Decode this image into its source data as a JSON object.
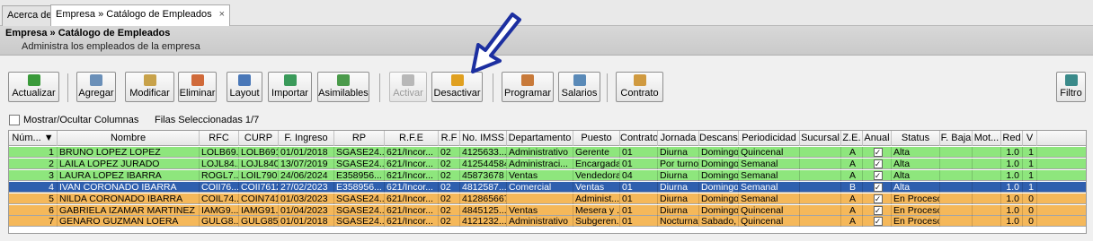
{
  "tabs": [
    {
      "label": "Acerca de",
      "close": ""
    },
    {
      "label": "Empresa » Catálogo de Empleados",
      "close": "×"
    }
  ],
  "header": {
    "title": "Empresa » Catálogo de Empleados",
    "subtitle": "Administra los empleados de la empresa"
  },
  "toolbar": {
    "buttons": [
      {
        "label": "Actualizar",
        "icon": "refresh-icon",
        "color": "#3a9a3a",
        "enabled": true
      },
      {
        "label": "Agregar",
        "icon": "add-icon",
        "color": "#6a8fb8",
        "enabled": true
      },
      {
        "label": "Modificar",
        "icon": "edit-icon",
        "color": "#c8a24a",
        "enabled": true
      },
      {
        "label": "Eliminar",
        "icon": "delete-icon",
        "color": "#d06a3a",
        "enabled": true
      },
      {
        "label": "Layout",
        "icon": "layout-icon",
        "color": "#4a78b8",
        "enabled": true
      },
      {
        "label": "Importar",
        "icon": "import-icon",
        "color": "#3a9a5a",
        "enabled": true
      },
      {
        "label": "Asimilables",
        "icon": "assimilable-icon",
        "color": "#4a9a4a",
        "enabled": true
      },
      {
        "label": "Activar",
        "icon": "activate-icon",
        "color": "#b8b8b8",
        "enabled": false
      },
      {
        "label": "Desactivar",
        "icon": "undo-icon",
        "color": "#e0a020",
        "enabled": true
      },
      {
        "label": "Programar",
        "icon": "schedule-icon",
        "color": "#c87a3a",
        "enabled": true
      },
      {
        "label": "Salarios",
        "icon": "salary-icon",
        "color": "#5a8ab8",
        "enabled": true
      },
      {
        "label": "Contrato",
        "icon": "contract-icon",
        "color": "#d09a40",
        "enabled": true
      },
      {
        "label": "Filtro",
        "icon": "filter-icon",
        "color": "#3a8a8a",
        "enabled": true
      }
    ]
  },
  "options": {
    "toggle_label": "Mostrar/Ocultar Columnas",
    "selected_label": "Filas Seleccionadas",
    "selected_value": "1/7"
  },
  "grid": {
    "columns": [
      "Núm... ▼",
      "Nombre",
      "RFC",
      "CURP",
      "F. Ingreso",
      "RP",
      "R.F.E",
      "R.F",
      "No. IMSS",
      "Departamento",
      "Puesto",
      "Contrato",
      "Jornada",
      "Descanso",
      "Periodicidad",
      "Sucursal",
      "Z.E.",
      "Anual",
      "Status",
      "F. Baja",
      "Mot...",
      "Red",
      "V"
    ],
    "rows": [
      {
        "cells": [
          "1",
          "BRUNO LOPEZ LOPEZ",
          "LOLB69...",
          "LOLB691...",
          "01/01/2018",
          "SGASE24...",
          "621/Incor...",
          "02",
          "4125633...",
          "Administrativo",
          "Gerente",
          "01",
          "Diurna",
          "Domingo",
          "Quincenal",
          "",
          "A",
          "✓",
          "Alta",
          "",
          "",
          "1.0",
          "1"
        ],
        "color": "#8ee67d",
        "selected": false
      },
      {
        "cells": [
          "2",
          "LAILA LOPEZ JURADO",
          "LOJL84...",
          "LOJL840...",
          "13/07/2019",
          "SGASE24...",
          "621/Incor...",
          "02",
          "412544584",
          "Administraci...",
          "Encargada",
          "01",
          "Por turnos",
          "Domingo",
          "Semanal",
          "",
          "A",
          "✓",
          "Alta",
          "",
          "",
          "1.0",
          "1"
        ],
        "color": "#8ee67d",
        "selected": false
      },
      {
        "cells": [
          "3",
          "LAURA LOPEZ IBARRA",
          "ROGL7...",
          "LOIL790...",
          "24/06/2024",
          "E358956...",
          "621/Incor...",
          "02",
          "45873678",
          "Ventas",
          "Vendedora",
          "04",
          "Diurna",
          "Domingo",
          "Semanal",
          "",
          "A",
          "✓",
          "Alta",
          "",
          "",
          "1.0",
          "1"
        ],
        "color": "#8ee67d",
        "selected": false
      },
      {
        "cells": [
          "4",
          "IVAN CORONADO IBARRA",
          "COII76...",
          "COII7612...",
          "27/02/2023",
          "E358956...",
          "621/Incor...",
          "02",
          "4812587...",
          "Comercial",
          "Ventas",
          "01",
          "Diurna",
          "Domingo",
          "Semanal",
          "",
          "B",
          "✓",
          "Alta",
          "",
          "",
          "1.0",
          "1"
        ],
        "color": "#2f5fae",
        "selected": true
      },
      {
        "cells": [
          "5",
          "NILDA CORONADO IBARRA",
          "COIL74...",
          "COIN741...",
          "01/03/2023",
          "SGASE24...",
          "621/Incor...",
          "02",
          "412865667",
          "",
          "Administ...",
          "01",
          "Diurna",
          "Domingo",
          "Semanal",
          "",
          "A",
          "✓",
          "En Proceso",
          "",
          "",
          "1.0",
          "0"
        ],
        "color": "#f5b85a",
        "selected": false
      },
      {
        "cells": [
          "6",
          "GABRIELA IZAMAR MARTINEZ",
          "IAMG9...",
          "IAMG91...",
          "01/04/2023",
          "SGASE24...",
          "621/Incor...",
          "02",
          "4845125...",
          "Ventas",
          "Mesera y ...",
          "01",
          "Diurna",
          "Domingo",
          "Quincenal",
          "",
          "A",
          "✓",
          "En Proceso",
          "",
          "",
          "1.0",
          "0"
        ],
        "color": "#f5b85a",
        "selected": false
      },
      {
        "cells": [
          "7",
          "GENARO GUZMAN LOERA",
          "GULG8...",
          "GULG85...",
          "01/01/2018",
          "SGASE24...",
          "621/Incor...",
          "02",
          "4121232...",
          "Administrativo",
          "Subgeren...",
          "01",
          "Nocturna",
          "Sabado, ...",
          "Quincenal",
          "",
          "A",
          "✓",
          "En Proceso",
          "",
          "",
          "1.0",
          "0"
        ],
        "color": "#f5b85a",
        "selected": false
      }
    ]
  }
}
